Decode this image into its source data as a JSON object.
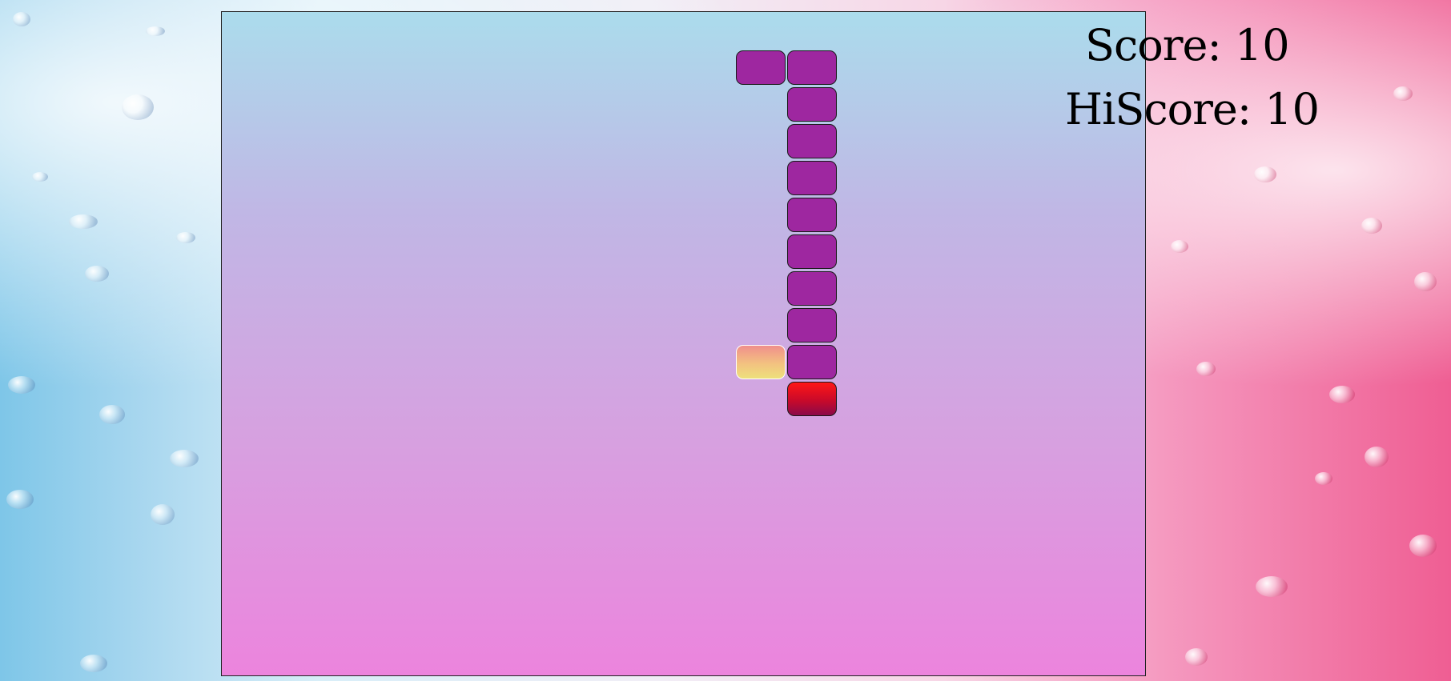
{
  "scoreboard": {
    "score_label": "Score:",
    "score_value": "10",
    "hiscore_label": "HiScore:",
    "hiscore_value": "10"
  },
  "game": {
    "snake_segment_count": 10,
    "food_count": 1,
    "colors": {
      "snake_body": "#9e27a0",
      "snake_head": "#ff1616",
      "food_top": "#f08f8c",
      "food_bottom": "#ede07c",
      "board_top": "#abdcec",
      "board_bottom": "#ec84dd"
    }
  }
}
